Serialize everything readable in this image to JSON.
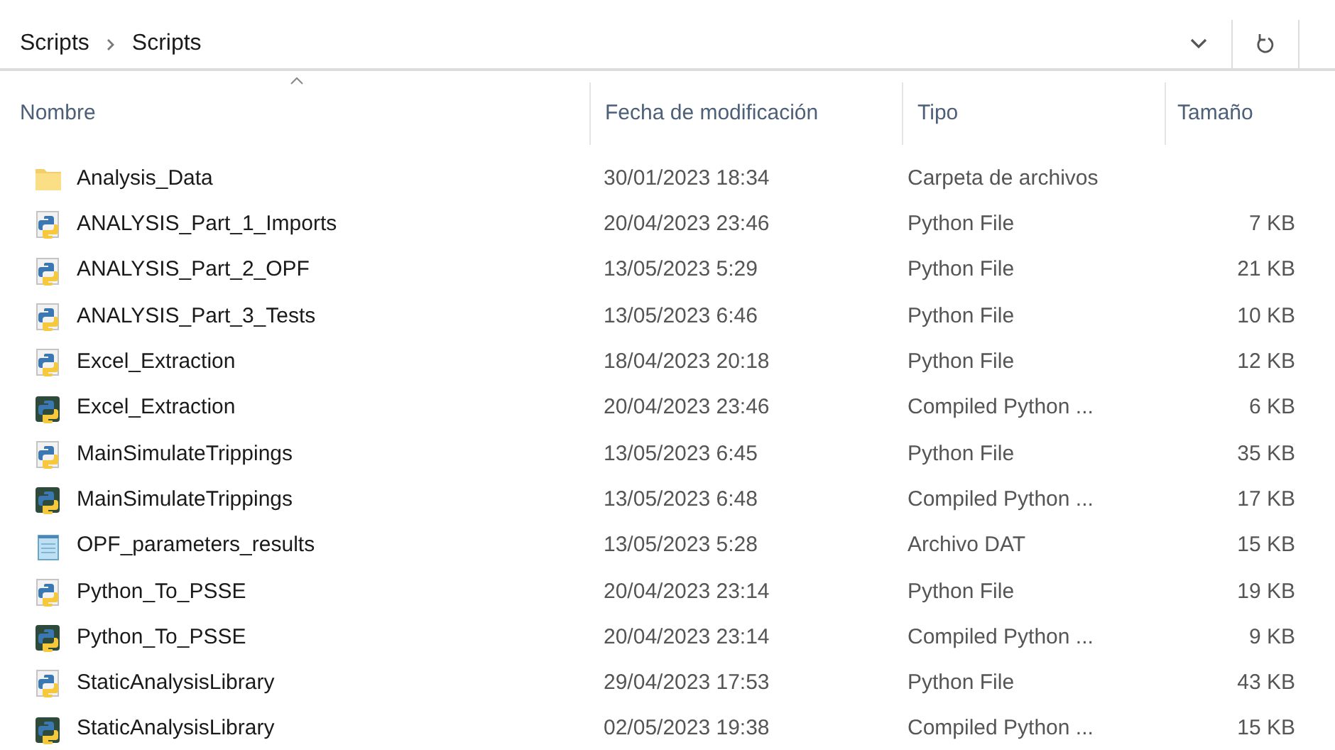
{
  "breadcrumb": [
    {
      "label": "Scripts"
    },
    {
      "label": "Scripts"
    }
  ],
  "columns": [
    {
      "label": "Nombre",
      "sorted": true
    },
    {
      "label": "Fecha de modificación",
      "sorted": false
    },
    {
      "label": "Tipo",
      "sorted": false
    },
    {
      "label": "Tamaño",
      "sorted": false
    }
  ],
  "rows": [
    {
      "kind": "folder",
      "name": "Analysis_Data",
      "date": "30/01/2023 18:34",
      "type": "Carpeta de archivos"
    },
    {
      "kind": "py",
      "name": "ANALYSIS_Part_1_Imports",
      "date": "20/04/2023 23:46",
      "type": "Python File",
      "size": "7 KB"
    },
    {
      "kind": "py",
      "name": "ANALYSIS_Part_2_OPF",
      "date": "13/05/2023 5:29",
      "type": "Python File",
      "size": "21 KB"
    },
    {
      "kind": "py",
      "name": "ANALYSIS_Part_3_Tests",
      "date": "13/05/2023 6:46",
      "type": "Python File",
      "size": "10 KB"
    },
    {
      "kind": "py",
      "name": "Excel_Extraction",
      "date": "18/04/2023 20:18",
      "type": "Python File",
      "size": "12 KB"
    },
    {
      "kind": "pyc",
      "name": "Excel_Extraction",
      "date": "20/04/2023 23:46",
      "type": "Compiled Python ...",
      "size": "6 KB"
    },
    {
      "kind": "py",
      "name": "MainSimulateTrippings",
      "date": "13/05/2023 6:45",
      "type": "Python File",
      "size": "35 KB"
    },
    {
      "kind": "pyc",
      "name": "MainSimulateTrippings",
      "date": "13/05/2023 6:48",
      "type": "Compiled Python ...",
      "size": "17 KB"
    },
    {
      "kind": "dat",
      "name": "OPF_parameters_results",
      "date": "13/05/2023 5:28",
      "type": "Archivo DAT",
      "size": "15 KB"
    },
    {
      "kind": "py",
      "name": "Python_To_PSSE",
      "date": "20/04/2023 23:14",
      "type": "Python File",
      "size": "19 KB"
    },
    {
      "kind": "pyc",
      "name": "Python_To_PSSE",
      "date": "20/04/2023 23:14",
      "type": "Compiled Python ...",
      "size": "9 KB"
    },
    {
      "kind": "py",
      "name": "StaticAnalysisLibrary",
      "date": "29/04/2023 17:53",
      "type": "Python File",
      "size": "43 KB"
    },
    {
      "kind": "pyc",
      "name": "StaticAnalysisLibrary",
      "date": "02/05/2023 19:38",
      "type": "Compiled Python ...",
      "size": "15 KB"
    }
  ]
}
